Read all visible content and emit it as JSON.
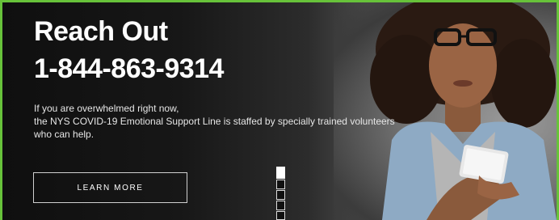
{
  "banner": {
    "headline": "Reach Out",
    "phone": "1-844-863-9314",
    "body_lines": [
      "If you are overwhelmed right now,",
      "the NYS COVID-19 Emotional Support Line is staffed by specially trained volunteers",
      "who can help."
    ],
    "cta_label": "LEARN MORE"
  },
  "colors": {
    "frame_green": "#67c23a",
    "text": "#ffffff",
    "background_dark": "#111111"
  },
  "icons": {
    "indicator": "slide-indicator-icon"
  }
}
